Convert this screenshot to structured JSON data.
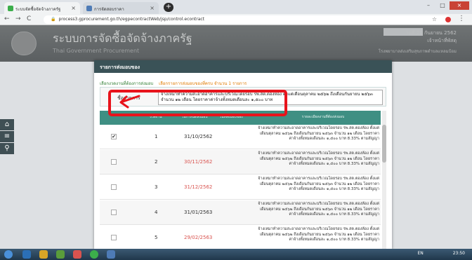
{
  "browser": {
    "tabs": [
      {
        "title": "ระบบจัดซื้อจัดจ้างภาครัฐ",
        "favicon_color": "#3cae4b"
      },
      {
        "title": "การจัดสอบราคา",
        "favicon_color": "#4e7bb6"
      }
    ],
    "url": "process3.gprocurement.go.th/egpecontractWeb/jsp/control.econtract",
    "new_tab_icon": "plus-icon",
    "menu_icon": "vertical-dots-icon"
  },
  "site": {
    "title": "ระบบการจัดซื้อจัดจ้างภาครัฐ",
    "subtitle": "Thai Government Procurement",
    "date": "วันที่ 20 กันยายน 2562",
    "user": "เจ้าหน้าที่พัสดุ",
    "department": "โรงพยาบาลส่งเสริมสุขภาพตำบลแหลมป้อม"
  },
  "side_buttons": [
    "home-icon",
    "menu-icon",
    "search-icon"
  ],
  "modal": {
    "title": "รายการส่งมอบของ",
    "selected_label": "เลือกงวดงานที่ต้องการส่งมอบ",
    "selected_info": "เลือกรายการส่งมอบของที่ครบ จำนวน 1 รายการ",
    "info_label": "ชื่อรายการ",
    "info_value": "จ้างเหมาทำความสะอาดอาคารและบริเวณโดยรอบ รพ.สต.ตองห้อง ตั้งแต่เดือนตุลาคม ๒๕๖๒ ถึงเดือนกันยายน ๒๕๖๓ จำนวน ๑๒ เดือน โดยราคาค่าจ้างทั้งหมดเดือนละ ๑,๕๐๐ บาท",
    "columns": [
      "*",
      "งวดงาน",
      "วันกำหนดส่งมอบ",
      "วันที่ส่งมอบของ",
      "รายละเอียดงานที่ต้องส่งมอบ"
    ],
    "rows": [
      {
        "checked": true,
        "installment": "1",
        "due_date": "31/10/2562",
        "overdue": false,
        "desc": "จ้างเหมาทำความสะอาดอาคารและบริเวณโดยรอบ รพ.สต.ตองห้อง ตั้งแต่เดือนตุลาคม ๒๕๖๒ ถึงเดือนกันยายน ๒๕๖๓ จำนวน ๑๒ เดือน โดยราคาค่าจ้างทั้งหมดเดือนละ ๑,๕๐๐ บาท 8.33% ตามสัญญา"
      },
      {
        "checked": false,
        "installment": "2",
        "due_date": "30/11/2562",
        "overdue": true,
        "desc": "จ้างเหมาทำความสะอาดอาคารและบริเวณโดยรอบ รพ.สต.ตองห้อง ตั้งแต่เดือนตุลาคม ๒๕๖๒ ถึงเดือนกันยายน ๒๕๖๓ จำนวน ๑๒ เดือน โดยราคาค่าจ้างทั้งหมดเดือนละ ๑,๕๐๐ บาท 8.33% ตามสัญญา"
      },
      {
        "checked": false,
        "installment": "3",
        "due_date": "31/12/2562",
        "overdue": true,
        "desc": "จ้างเหมาทำความสะอาดอาคารและบริเวณโดยรอบ รพ.สต.ตองห้อง ตั้งแต่เดือนตุลาคม ๒๕๖๒ ถึงเดือนกันยายน ๒๕๖๓ จำนวน ๑๒ เดือน โดยราคาค่าจ้างทั้งหมดเดือนละ ๑,๕๐๐ บาท 8.33% ตามสัญญา"
      },
      {
        "checked": false,
        "installment": "4",
        "due_date": "31/01/2563",
        "overdue": false,
        "desc": "จ้างเหมาทำความสะอาดอาคารและบริเวณโดยรอบ รพ.สต.ตองห้อง ตั้งแต่เดือนตุลาคม ๒๕๖๒ ถึงเดือนกันยายน ๒๕๖๓ จำนวน ๑๒ เดือน โดยราคาค่าจ้างทั้งหมดเดือนละ ๑,๕๐๐ บาท 8.33% ตามสัญญา"
      },
      {
        "checked": false,
        "installment": "5",
        "due_date": "29/02/2563",
        "overdue": true,
        "desc": "จ้างเหมาทำความสะอาดอาคารและบริเวณโดยรอบ รพ.สต.ตองห้อง ตั้งแต่เดือนตุลาคม ๒๕๖๒ ถึงเดือนกันยายน ๒๕๖๓ จำนวน ๑๒ เดือน โดยราคาค่าจ้างทั้งหมดเดือนละ ๑,๕๐๐ บาท 8.33% ตามสัญญา"
      }
    ]
  },
  "colors": {
    "accent_red": "#e8131b",
    "header_teal": "#3f8f83",
    "modal_head": "#3a5257"
  },
  "taskbar": {
    "lang": "EN",
    "time": "23:50"
  }
}
